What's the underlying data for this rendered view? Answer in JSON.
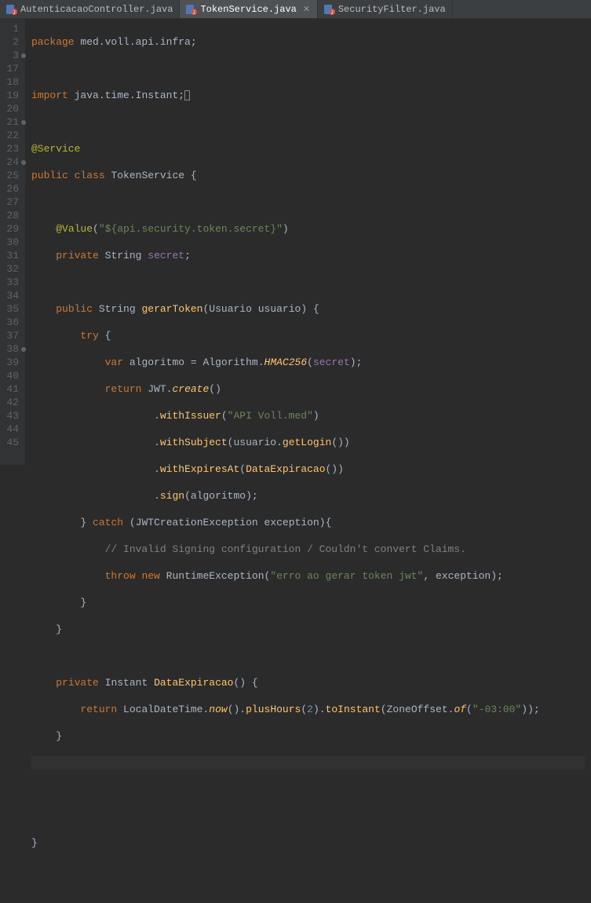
{
  "tabs": [
    {
      "label": "AutenticacaoController.java",
      "active": false
    },
    {
      "label": "TokenService.java",
      "active": true
    },
    {
      "label": "SecurityFilter.java",
      "active": false
    }
  ],
  "lineNumbers": [
    "1",
    "2",
    "3",
    "17",
    "18",
    "19",
    "20",
    "21",
    "22",
    "23",
    "24",
    "25",
    "26",
    "27",
    "28",
    "29",
    "30",
    "31",
    "32",
    "33",
    "34",
    "35",
    "36",
    "37",
    "38",
    "39",
    "40",
    "41",
    "42",
    "43",
    "44",
    "45"
  ],
  "marks": {
    "3": true,
    "21": true,
    "24": true,
    "38": true
  },
  "code": {
    "l1_pkg": "package",
    "l1_path": "med.voll.api.infra",
    "l3_import": "import",
    "l3_path": "java.time.Instant",
    "l18_anno": "@Service",
    "l19_public": "public",
    "l19_class": "class",
    "l19_name": "TokenService",
    "l21_anno": "@Value",
    "l21_str": "\"${api.security.token.secret}\"",
    "l22_private": "private",
    "l22_type": "String",
    "l22_name": "secret",
    "l24_public": "public",
    "l24_ret": "String",
    "l24_name": "gerarToken",
    "l24_ptype": "Usuario",
    "l24_pname": "usuario",
    "l25_try": "try",
    "l26_var": "var",
    "l26_vname": "algoritmo",
    "l26_cls": "Algorithm",
    "l26_meth": "HMAC256",
    "l26_arg": "secret",
    "l27_return": "return",
    "l27_cls": "JWT",
    "l27_meth": "create",
    "l28_meth": "withIssuer",
    "l28_str": "\"API Voll.med\"",
    "l29_meth": "withSubject",
    "l29_obj": "usuario",
    "l29_call": "getLogin",
    "l30_meth": "withExpiresAt",
    "l30_call": "DataExpiracao",
    "l31_meth": "sign",
    "l31_arg": "algoritmo",
    "l32_catch": "catch",
    "l32_extype": "JWTCreationException",
    "l32_exname": "exception",
    "l33_comment": "// Invalid Signing configuration / Couldn't convert Claims.",
    "l34_throw": "throw",
    "l34_new": "new",
    "l34_cls": "RuntimeException",
    "l34_str": "\"erro ao gerar token jwt\"",
    "l34_arg": "exception",
    "l38_private": "private",
    "l38_ret": "Instant",
    "l38_name": "DataExpiracao",
    "l39_return": "return",
    "l39_cls": "LocalDateTime",
    "l39_now": "now",
    "l39_plus": "plusHours",
    "l39_num": "2",
    "l39_toi": "toInstant",
    "l39_zone": "ZoneOffset",
    "l39_of": "of",
    "l39_str": "\"-03:00\""
  }
}
